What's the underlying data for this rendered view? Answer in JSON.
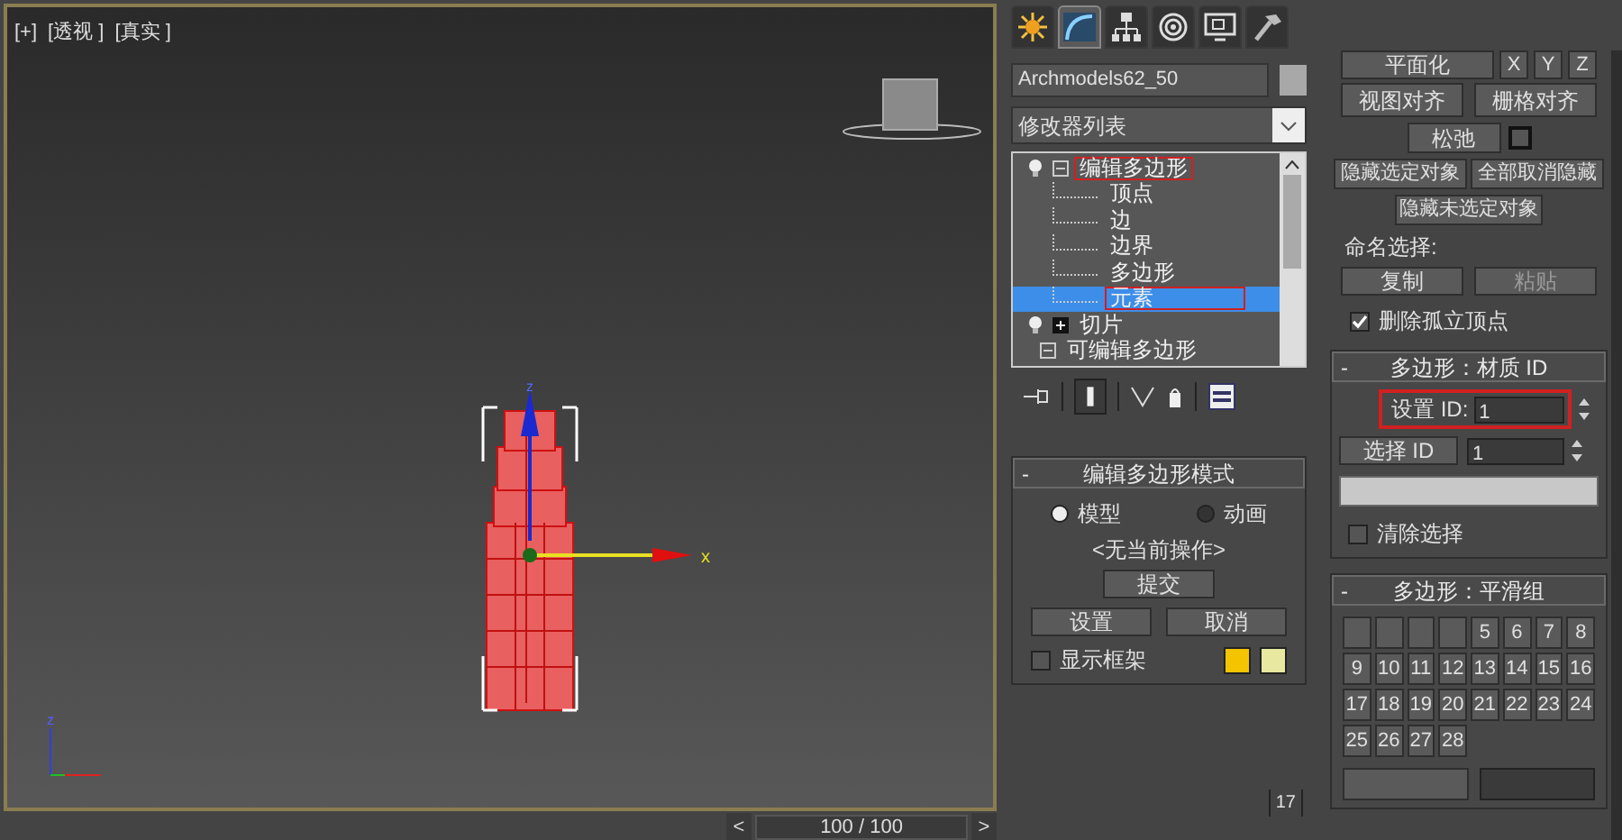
{
  "viewport": {
    "labels": [
      "[+]",
      "[透视 ]",
      "[真实 ]"
    ],
    "gizmo_labels": {
      "x": "x",
      "z": "z"
    },
    "tripod_label": "z"
  },
  "timeline": {
    "prev": "<",
    "frame": "100 / 100",
    "next": ">"
  },
  "command_tabs": [
    {
      "kind": "create",
      "selected": false
    },
    {
      "kind": "modify",
      "selected": true
    },
    {
      "kind": "hierarchy",
      "selected": false
    },
    {
      "kind": "motion",
      "selected": false
    },
    {
      "kind": "display",
      "selected": false
    },
    {
      "kind": "utilities",
      "selected": false
    }
  ],
  "object_name": "Archmodels62_50",
  "modifier_list": "修改器列表",
  "stack": [
    {
      "label": "编辑多边形",
      "kind": "modifier",
      "expanded": true,
      "annotated": true,
      "selected": false,
      "children": [
        {
          "label": "顶点",
          "selected": false,
          "annotated": false
        },
        {
          "label": "边",
          "selected": false,
          "annotated": false
        },
        {
          "label": "边界",
          "selected": false,
          "annotated": false
        },
        {
          "label": "多边形",
          "selected": false,
          "annotated": false
        },
        {
          "label": "元素",
          "selected": true,
          "annotated": true
        }
      ]
    },
    {
      "label": "切片",
      "kind": "modifier",
      "expanded": false,
      "annotated": false,
      "selected": false
    },
    {
      "label": "可编辑多边形",
      "kind": "base",
      "expanded": true,
      "annotated": false,
      "selected": false
    }
  ],
  "edit_mode": {
    "title": "编辑多边形模式",
    "collapse": "-",
    "radios": [
      {
        "label": "模型",
        "selected": true
      },
      {
        "label": "动画",
        "selected": false
      }
    ],
    "status": "<无当前操作>",
    "commit": "提交",
    "buttons": [
      "设置",
      "取消"
    ],
    "show_cage": {
      "label": "显示框架",
      "checked": false
    },
    "cage_colors": [
      {
        "color": "#f5c400"
      },
      {
        "color": "#e8e8a0"
      }
    ]
  },
  "status_field": "17",
  "geometry": {
    "planarize": "平面化",
    "axes": [
      "X",
      "Y",
      "Z"
    ],
    "row1": [
      "视图对齐",
      "栅格对齐"
    ],
    "relax": "松弛",
    "row2": [
      "隐藏选定对象",
      "全部取消隐藏"
    ],
    "hide_unselected": "隐藏未选定对象",
    "named_selection": "命名选择:",
    "row3": [
      {
        "label": "复制",
        "disabled": false
      },
      {
        "label": "粘贴",
        "disabled": true
      }
    ],
    "delete_isolated": {
      "label": "删除孤立顶点",
      "checked": true
    }
  },
  "material_id": {
    "title": "多边形：材质 ID",
    "collapse": "-",
    "set_id": {
      "label": "设置 ID:",
      "value": "1",
      "annotated": true
    },
    "select_id": {
      "label": "选择 ID",
      "value": "1"
    },
    "clear_selection": {
      "label": "清除选择",
      "checked": false
    }
  },
  "smoothing": {
    "title": "多边形：平滑组",
    "collapse": "-",
    "buttons": [
      {
        "kind": "blank"
      },
      {
        "kind": "blank"
      },
      {
        "kind": "blank"
      },
      {
        "kind": "blank"
      },
      {
        "kind": "number",
        "label": "5"
      },
      {
        "kind": "number",
        "label": "6"
      },
      {
        "kind": "number",
        "label": "7"
      },
      {
        "kind": "number",
        "label": "8"
      },
      {
        "kind": "number",
        "label": "9"
      },
      {
        "kind": "number",
        "label": "10"
      },
      {
        "kind": "number",
        "label": "11"
      },
      {
        "kind": "number",
        "label": "12"
      },
      {
        "kind": "number",
        "label": "13"
      },
      {
        "kind": "number",
        "label": "14"
      },
      {
        "kind": "number",
        "label": "15"
      },
      {
        "kind": "number",
        "label": "16"
      },
      {
        "kind": "number",
        "label": "17"
      },
      {
        "kind": "number",
        "label": "18"
      },
      {
        "kind": "number",
        "label": "19"
      },
      {
        "kind": "number",
        "label": "20"
      },
      {
        "kind": "number",
        "label": "21"
      },
      {
        "kind": "number",
        "label": "22"
      },
      {
        "kind": "number",
        "label": "23"
      },
      {
        "kind": "number",
        "label": "24"
      },
      {
        "kind": "number",
        "label": "25"
      },
      {
        "kind": "number",
        "label": "26"
      },
      {
        "kind": "number",
        "label": "27"
      },
      {
        "kind": "number",
        "label": "28"
      }
    ]
  }
}
